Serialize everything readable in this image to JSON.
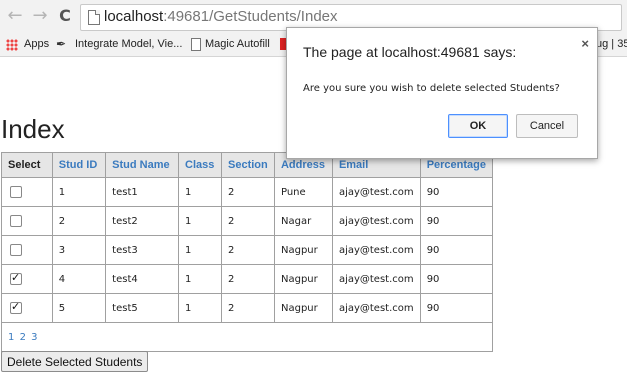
{
  "browser": {
    "url_host": "localhost",
    "url_path": ":49681/GetStudents/Index",
    "bookmarks": [
      {
        "label": "Apps"
      },
      {
        "label": "Integrate Model, Vie..."
      },
      {
        "label": "Magic Autofill"
      },
      {
        "label": "ug | 35"
      }
    ]
  },
  "page": {
    "title": "Index",
    "columns": [
      "Select",
      "Stud ID",
      "Stud Name",
      "Class",
      "Section",
      "Address",
      "Email",
      "Percentage"
    ],
    "rows": [
      {
        "checked": false,
        "id": "1",
        "name": "test1",
        "class": "1",
        "section": "2",
        "address": "Pune",
        "email": "ajay@test.com",
        "percentage": "90"
      },
      {
        "checked": false,
        "id": "2",
        "name": "test2",
        "class": "1",
        "section": "2",
        "address": "Nagar",
        "email": "ajay@test.com",
        "percentage": "90"
      },
      {
        "checked": false,
        "id": "3",
        "name": "test3",
        "class": "1",
        "section": "2",
        "address": "Nagpur",
        "email": "ajay@test.com",
        "percentage": "90"
      },
      {
        "checked": true,
        "id": "4",
        "name": "test4",
        "class": "1",
        "section": "2",
        "address": "Nagpur",
        "email": "ajay@test.com",
        "percentage": "90"
      },
      {
        "checked": true,
        "id": "5",
        "name": "test5",
        "class": "1",
        "section": "2",
        "address": "Nagpur",
        "email": "ajay@test.com",
        "percentage": "90"
      }
    ],
    "pager": [
      "1",
      "2",
      "3"
    ],
    "delete_button": "Delete Selected Students"
  },
  "dialog": {
    "title": "The page at localhost:49681 says:",
    "close": "×",
    "message": "Are you sure you wish to delete selected Students?",
    "ok_label": "OK",
    "cancel_label": "Cancel"
  },
  "colors": {
    "link": "#3b7bbf",
    "dialog_focus": "#4d90fe"
  }
}
